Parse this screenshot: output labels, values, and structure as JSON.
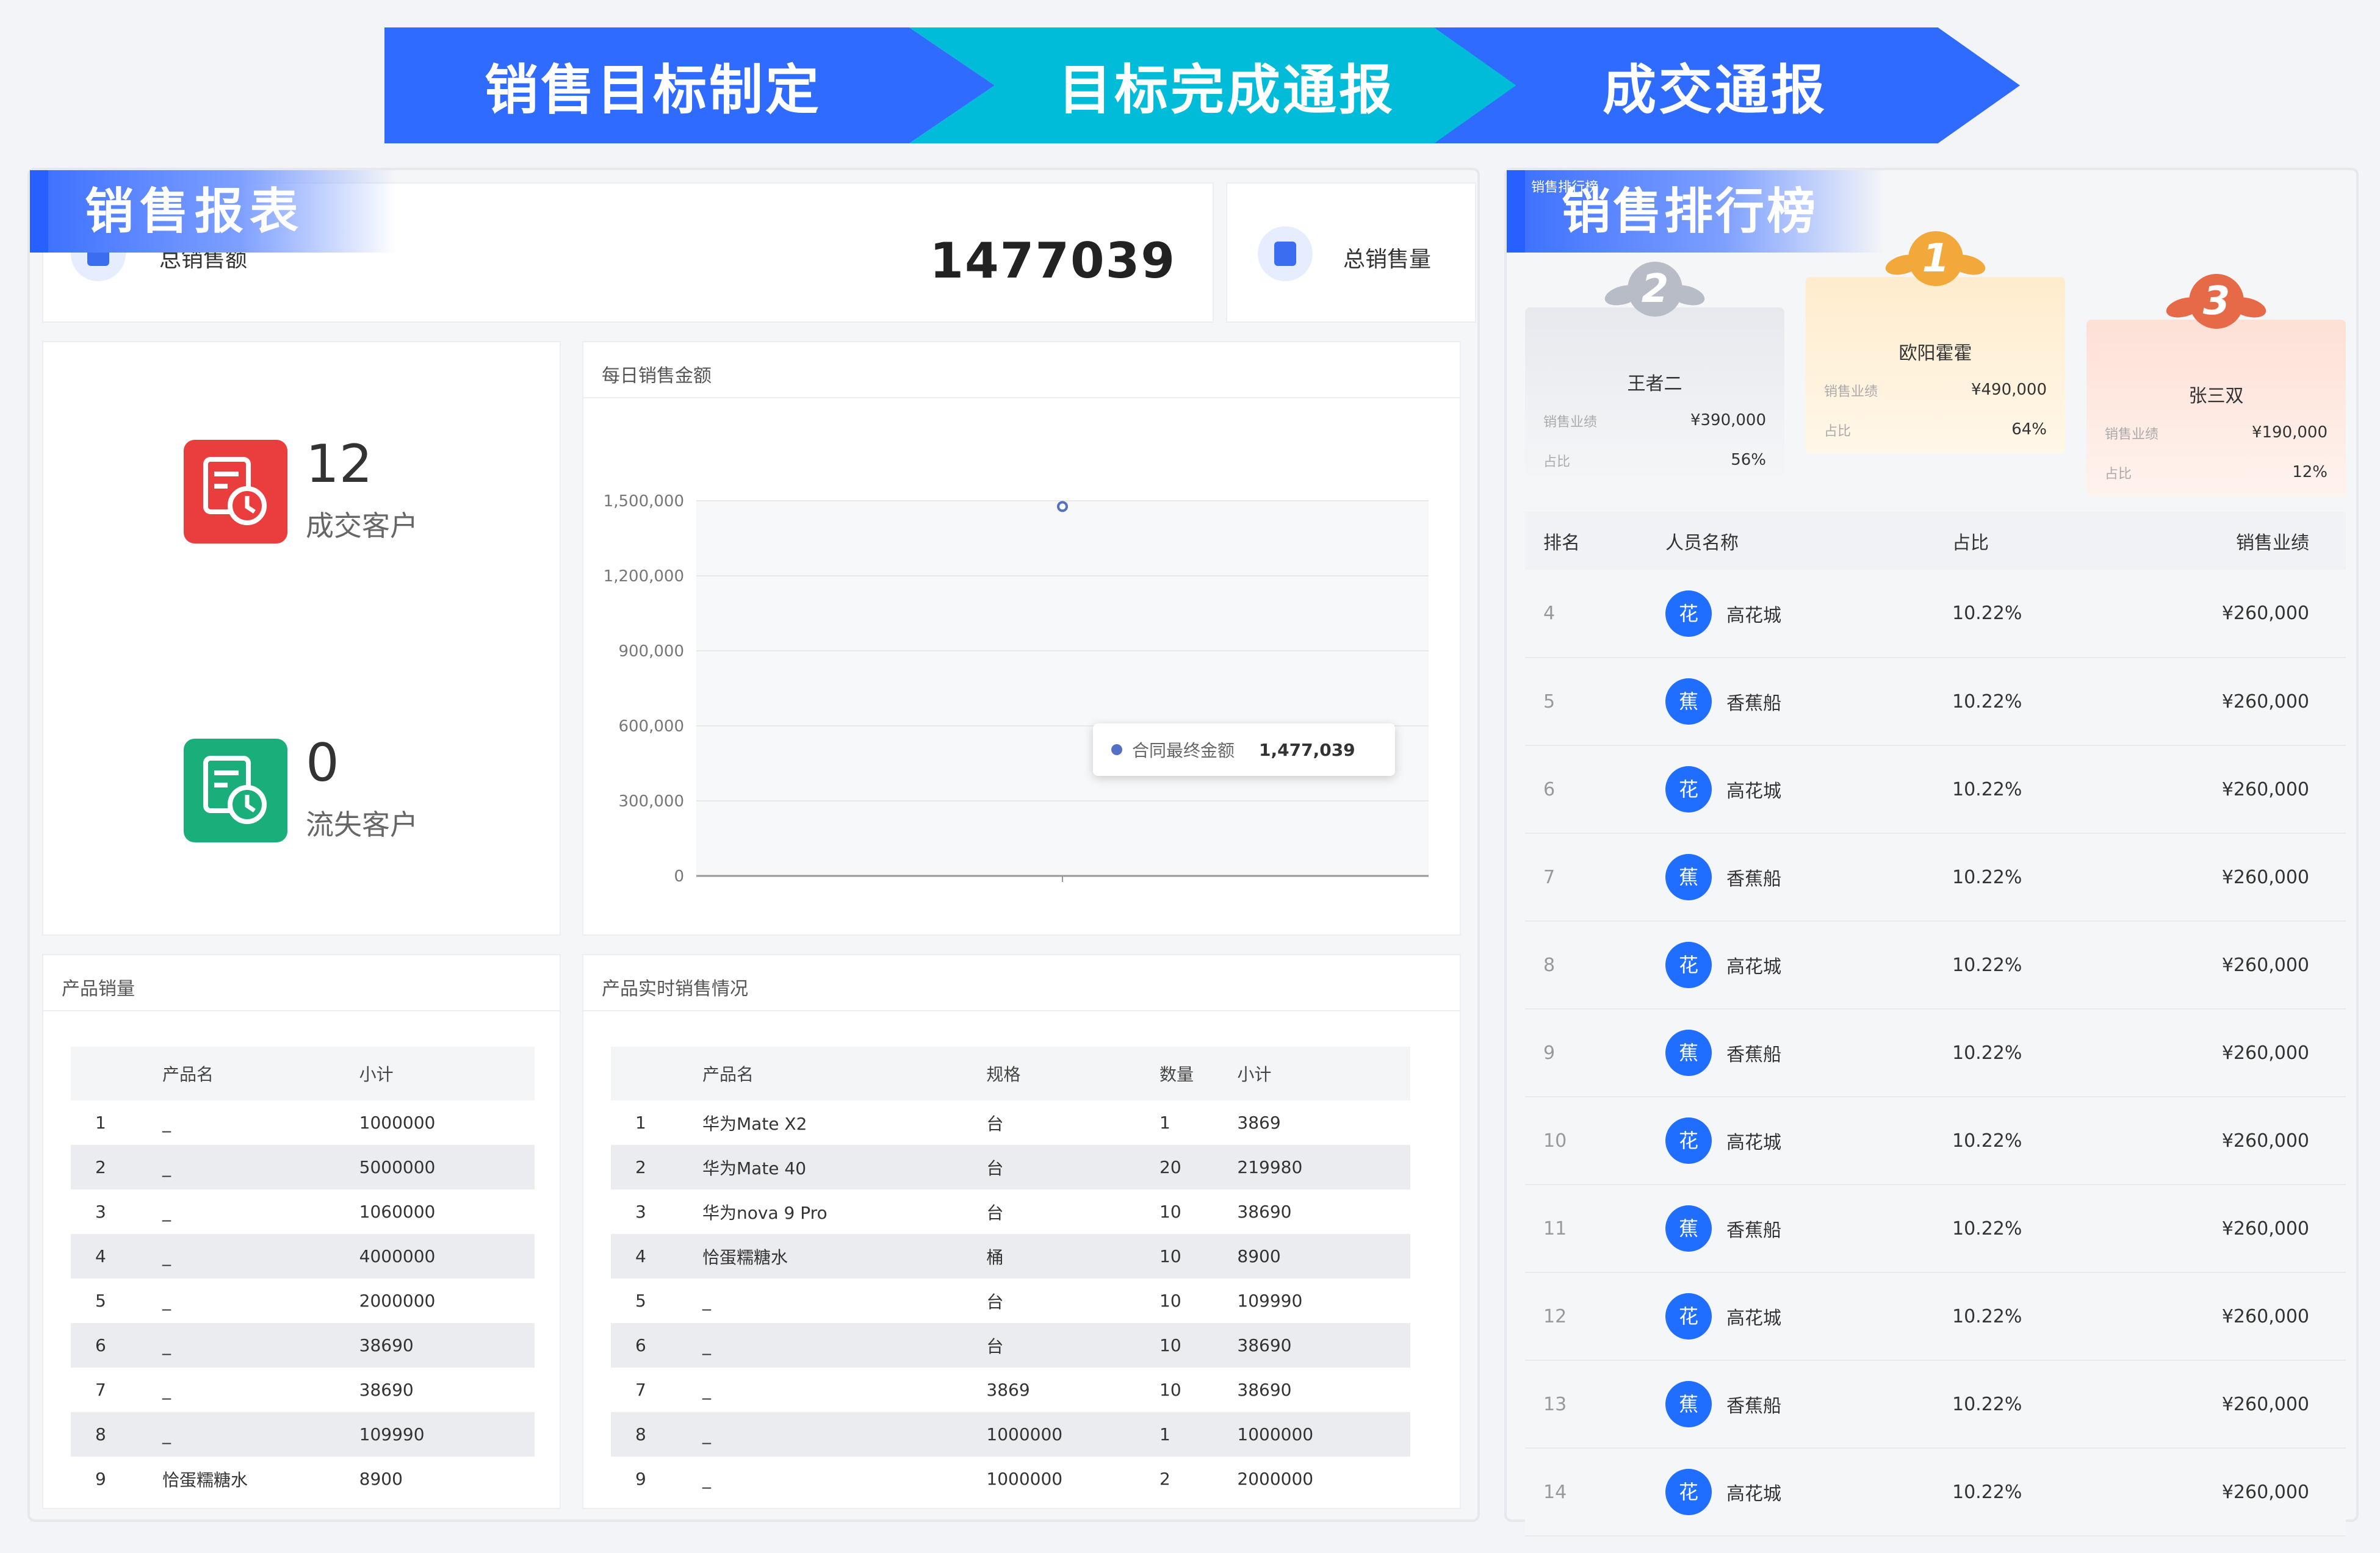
{
  "process": {
    "steps": [
      "销售目标制定",
      "目标完成通报",
      "成交通报"
    ]
  },
  "report": {
    "title": "销售报表",
    "total_sales_label": "总销售额",
    "total_sales_value": "1477039",
    "total_qty_label": "总销售量"
  },
  "customers": {
    "deal_count": "12",
    "deal_label": "成交客户",
    "lost_count": "0",
    "lost_label": "流失客户"
  },
  "daily_chart": {
    "title": "每日销售金额",
    "tooltip_series": "合同最终金额",
    "tooltip_value": "1,477,039"
  },
  "chart_data": {
    "type": "line",
    "title": "每日销售金额",
    "series": [
      {
        "name": "合同最终金额",
        "values": [
          1477039
        ]
      }
    ],
    "y_ticks": [
      "0",
      "300,000",
      "600,000",
      "900,000",
      "1,200,000",
      "1,500,000"
    ],
    "ylim": [
      0,
      1500000
    ],
    "grid": true
  },
  "product_sales": {
    "title": "产品销量",
    "headers": [
      "",
      "产品名",
      "小计"
    ],
    "rows": [
      [
        "1",
        "_",
        "1000000"
      ],
      [
        "2",
        "_",
        "5000000"
      ],
      [
        "3",
        "_",
        "1060000"
      ],
      [
        "4",
        "_",
        "4000000"
      ],
      [
        "5",
        "_",
        "2000000"
      ],
      [
        "6",
        "_",
        "38690"
      ],
      [
        "7",
        "_",
        "38690"
      ],
      [
        "8",
        "_",
        "109990"
      ],
      [
        "9",
        "恰蛋糯糖水",
        "8900"
      ]
    ]
  },
  "realtime_sales": {
    "title": "产品实时销售情况",
    "headers": [
      "",
      "产品名",
      "规格",
      "数量",
      "小计"
    ],
    "rows": [
      [
        "1",
        "华为Mate X2",
        "台",
        "1",
        "3869"
      ],
      [
        "2",
        "华为Mate 40",
        "台",
        "20",
        "219980"
      ],
      [
        "3",
        "华为nova 9 Pro",
        "台",
        "10",
        "38690"
      ],
      [
        "4",
        "恰蛋糯糖水",
        "桶",
        "10",
        "8900"
      ],
      [
        "5",
        "_",
        "台",
        "10",
        "109990"
      ],
      [
        "6",
        "_",
        "台",
        "10",
        "38690"
      ],
      [
        "7",
        "_",
        "3869",
        "10",
        "38690"
      ],
      [
        "8",
        "_",
        "1000000",
        "1",
        "1000000"
      ],
      [
        "9",
        "_",
        "1000000",
        "2",
        "2000000"
      ]
    ]
  },
  "ranking": {
    "title": "销售排行榜",
    "tag": "销售排行榜",
    "podium": [
      {
        "rank": "2",
        "name": "王者二",
        "perf_label": "销售业绩",
        "perf": "¥390,000",
        "ratio_label": "占比",
        "ratio": "56%"
      },
      {
        "rank": "1",
        "name": "欧阳霍霍",
        "perf_label": "销售业绩",
        "perf": "¥490,000",
        "ratio_label": "占比",
        "ratio": "64%"
      },
      {
        "rank": "3",
        "name": "张三双",
        "perf_label": "销售业绩",
        "perf": "¥190,000",
        "ratio_label": "占比",
        "ratio": "12%"
      }
    ],
    "headers": [
      "排名",
      "人员名称",
      "占比",
      "销售业绩"
    ],
    "rows": [
      {
        "rank": "4",
        "avatar": "花",
        "name": "高花城",
        "pct": "10.22%",
        "amount": "¥260,000"
      },
      {
        "rank": "5",
        "avatar": "蕉",
        "name": "香蕉船",
        "pct": "10.22%",
        "amount": "¥260,000"
      },
      {
        "rank": "6",
        "avatar": "花",
        "name": "高花城",
        "pct": "10.22%",
        "amount": "¥260,000"
      },
      {
        "rank": "7",
        "avatar": "蕉",
        "name": "香蕉船",
        "pct": "10.22%",
        "amount": "¥260,000"
      },
      {
        "rank": "8",
        "avatar": "花",
        "name": "高花城",
        "pct": "10.22%",
        "amount": "¥260,000"
      },
      {
        "rank": "9",
        "avatar": "蕉",
        "name": "香蕉船",
        "pct": "10.22%",
        "amount": "¥260,000"
      },
      {
        "rank": "10",
        "avatar": "花",
        "name": "高花城",
        "pct": "10.22%",
        "amount": "¥260,000"
      },
      {
        "rank": "11",
        "avatar": "蕉",
        "name": "香蕉船",
        "pct": "10.22%",
        "amount": "¥260,000"
      },
      {
        "rank": "12",
        "avatar": "花",
        "name": "高花城",
        "pct": "10.22%",
        "amount": "¥260,000"
      },
      {
        "rank": "13",
        "avatar": "蕉",
        "name": "香蕉船",
        "pct": "10.22%",
        "amount": "¥260,000"
      },
      {
        "rank": "14",
        "avatar": "花",
        "name": "高花城",
        "pct": "10.22%",
        "amount": "¥260,000"
      }
    ]
  },
  "colors": {
    "primary": "#2f6bff",
    "cyan": "#00bcd8",
    "red": "#ea3d3d",
    "green": "#19ae7a",
    "series": "#5470c6"
  }
}
